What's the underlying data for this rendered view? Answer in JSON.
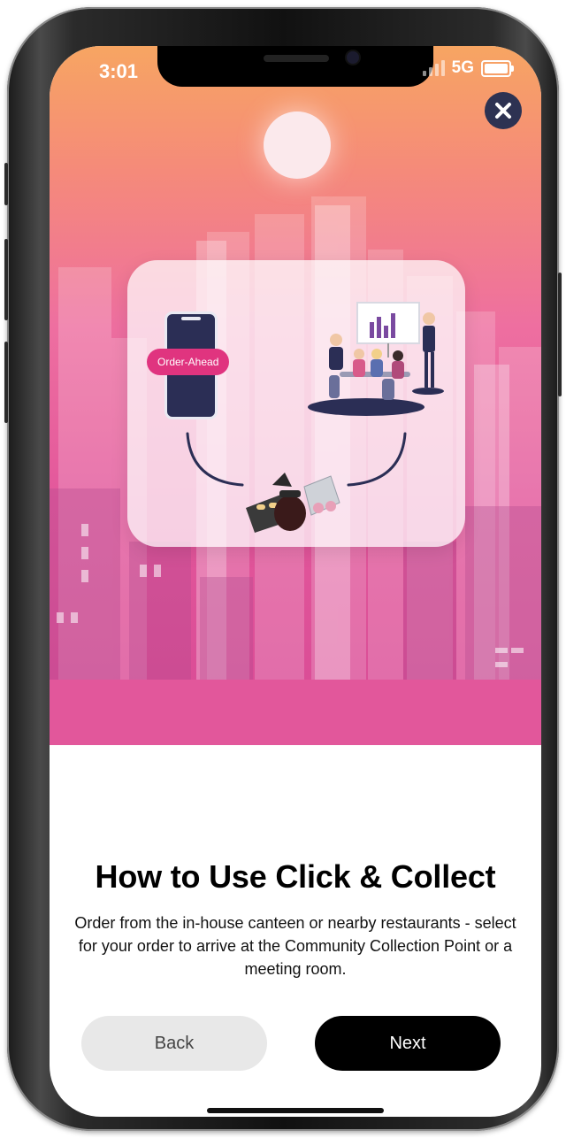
{
  "status_bar": {
    "time": "3:01",
    "network": "5G"
  },
  "hero": {
    "order_pill": "Order-Ahead"
  },
  "content": {
    "title": "How to Use Click & Collect",
    "description": "Order from the in-house canteen or nearby restaurants - select for your order to arrive at the Community Collection Point or a meeting room."
  },
  "buttons": {
    "back": "Back",
    "next": "Next"
  },
  "colors": {
    "accent_pink": "#e2579b",
    "close_button": "#2d3252",
    "next_button": "#000000",
    "back_button": "#e8e8e8"
  },
  "icons": {
    "close": "close-icon"
  }
}
